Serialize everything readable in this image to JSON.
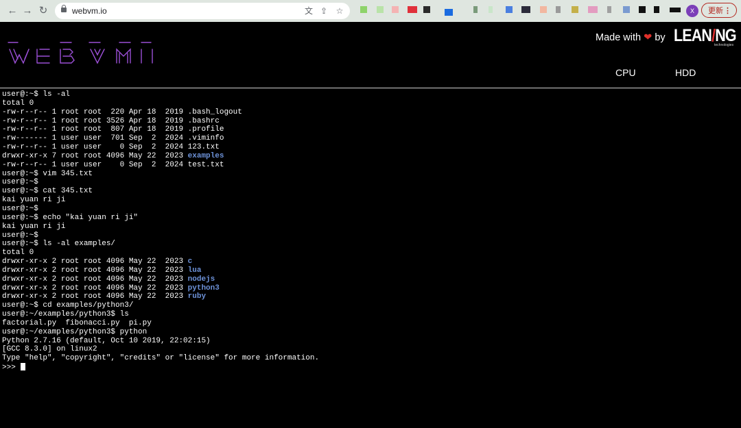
{
  "browser": {
    "url": "webvm.io",
    "avatar_initial": "X",
    "update_label": "更新",
    "update_more": "⋮"
  },
  "header": {
    "made_with": "Made with",
    "by": "by",
    "brand_part1": "LEAN",
    "brand_slash": "/",
    "brand_part2": "NG",
    "brand_sub": "technologies",
    "tabs": [
      "CPU",
      "HDD"
    ]
  },
  "terminal": {
    "lines": [
      [
        {
          "t": "user@:~$ ls -al"
        }
      ],
      [
        {
          "t": "total 0"
        }
      ],
      [
        {
          "t": "-rw-r--r-- 1 root root  220 Apr 18  2019 .bash_logout"
        }
      ],
      [
        {
          "t": "-rw-r--r-- 1 root root 3526 Apr 18  2019 .bashrc"
        }
      ],
      [
        {
          "t": "-rw-r--r-- 1 root root  807 Apr 18  2019 .profile"
        }
      ],
      [
        {
          "t": "-rw------- 1 user user  701 Sep  2  2024 .viminfo"
        }
      ],
      [
        {
          "t": "-rw-r--r-- 1 user user    0 Sep  2  2024 123.txt"
        }
      ],
      [
        {
          "t": "drwxr-xr-x 7 root root 4096 May 22  2023 "
        },
        {
          "t": "examples",
          "c": "dir"
        }
      ],
      [
        {
          "t": "-rw-r--r-- 1 user user    0 Sep  2  2024 test.txt"
        }
      ],
      [
        {
          "t": "user@:~$ vim 345.txt"
        }
      ],
      [
        {
          "t": "user@:~$"
        }
      ],
      [
        {
          "t": "user@:~$ cat 345.txt"
        }
      ],
      [
        {
          "t": "kai yuan ri ji"
        }
      ],
      [
        {
          "t": "user@:~$"
        }
      ],
      [
        {
          "t": "user@:~$ echo \"kai yuan ri ji\""
        }
      ],
      [
        {
          "t": "kai yuan ri ji"
        }
      ],
      [
        {
          "t": "user@:~$"
        }
      ],
      [
        {
          "t": "user@:~$ ls -al examples/"
        }
      ],
      [
        {
          "t": "total 0"
        }
      ],
      [
        {
          "t": "drwxr-xr-x 2 root root 4096 May 22  2023 "
        },
        {
          "t": "c",
          "c": "dir"
        }
      ],
      [
        {
          "t": "drwxr-xr-x 2 root root 4096 May 22  2023 "
        },
        {
          "t": "lua",
          "c": "dir"
        }
      ],
      [
        {
          "t": "drwxr-xr-x 2 root root 4096 May 22  2023 "
        },
        {
          "t": "nodejs",
          "c": "dir"
        }
      ],
      [
        {
          "t": "drwxr-xr-x 2 root root 4096 May 22  2023 "
        },
        {
          "t": "python3",
          "c": "dir"
        }
      ],
      [
        {
          "t": "drwxr-xr-x 2 root root 4096 May 22  2023 "
        },
        {
          "t": "ruby",
          "c": "dir"
        }
      ],
      [
        {
          "t": "user@:~$ cd examples/python3/"
        }
      ],
      [
        {
          "t": "user@:~/examples/python3$ ls"
        }
      ],
      [
        {
          "t": "factorial.py  fibonacci.py  pi.py"
        }
      ],
      [
        {
          "t": "user@:~/examples/python3$ python"
        }
      ],
      [
        {
          "t": "Python 2.7.16 (default, Oct 10 2019, 22:02:15)"
        }
      ],
      [
        {
          "t": "[GCC 8.3.0] on linux2"
        }
      ],
      [
        {
          "t": "Type \"help\", \"copyright\", \"credits\" or \"license\" for more information."
        }
      ],
      [
        {
          "t": ">>> "
        }
      ]
    ]
  },
  "colors": {
    "directory": "#6d92d9",
    "background": "#000000",
    "accent_red": "#e03030"
  }
}
